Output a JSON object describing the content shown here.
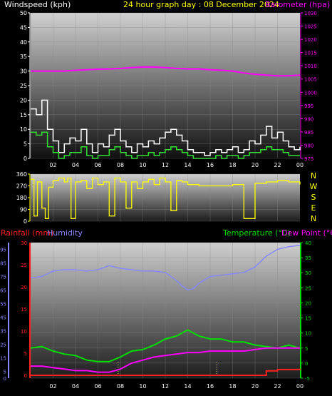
{
  "header": {
    "windspeed_label": "Windspeed (kph)",
    "center_title": "24 hour graph day : 08 December 2024",
    "barometer_label": "Barometer (hpa)",
    "rainfall_label": "Rainfall (mm)",
    "humidity_label": "Humidity",
    "temperature_label": "Temperature (°C)",
    "dewpoint_label": "Dew Point (°C)"
  },
  "colors": {
    "windspeed_label": "#ffffff",
    "title": "#ffff00",
    "barometer": "#ff00ff",
    "gust": "#ffffff",
    "avg_wind": "#33dd33",
    "direction": "#ffff00",
    "rainfall": "#ff2020",
    "humidity": "#8888ff",
    "temperature": "#00dd00",
    "dewpoint": "#ff00ff",
    "compass": "#ffff00"
  },
  "compass": [
    "N",
    "W",
    "S",
    "E",
    "N"
  ],
  "chart_data": [
    {
      "type": "line",
      "x_ticks": [
        "02",
        "04",
        "06",
        "08",
        "10",
        "12",
        "14",
        "16",
        "18",
        "20",
        "22",
        "00"
      ],
      "y_left_ticks": [
        "0",
        "5",
        "10",
        "15",
        "20",
        "25",
        "30",
        "35",
        "40",
        "45",
        "50"
      ],
      "y_right_ticks": [
        "975",
        "980",
        "985",
        "990",
        "995",
        "1000",
        "1005",
        "1010",
        "1015",
        "1020",
        "1025",
        "1030"
      ],
      "ylim_left": [
        0,
        50
      ],
      "ylim_right": [
        975,
        1030
      ],
      "series": [
        {
          "name": "Windspeed (kph)",
          "axis": "left",
          "x": [
            0,
            0.5,
            1,
            1.5,
            2,
            2.5,
            3,
            3.5,
            4,
            4.5,
            5,
            5.5,
            6,
            6.5,
            7,
            7.5,
            8,
            8.5,
            9,
            9.5,
            10,
            10.5,
            11,
            11.5,
            12,
            12.5,
            13,
            13.5,
            14,
            14.5,
            15,
            15.5,
            16,
            16.5,
            17,
            17.5,
            18,
            18.5,
            19,
            19.5,
            20,
            20.5,
            21,
            21.5,
            22,
            22.5,
            23,
            23.5,
            24
          ],
          "values": [
            17,
            15,
            20,
            10,
            6,
            2,
            5,
            7,
            6,
            10,
            5,
            2,
            5,
            4,
            8,
            10,
            6,
            4,
            2,
            5,
            4,
            6,
            5,
            7,
            9,
            10,
            8,
            6,
            3,
            2,
            2,
            1,
            2,
            3,
            2,
            3,
            4,
            2,
            3,
            6,
            5,
            8,
            11,
            7,
            9,
            6,
            4,
            3,
            4
          ]
        },
        {
          "name": "Average",
          "axis": "left",
          "x": [
            0,
            0.5,
            1,
            1.5,
            2,
            2.5,
            3,
            3.5,
            4,
            4.5,
            5,
            5.5,
            6,
            6.5,
            7,
            7.5,
            8,
            8.5,
            9,
            9.5,
            10,
            10.5,
            11,
            11.5,
            12,
            12.5,
            13,
            13.5,
            14,
            14.5,
            15,
            15.5,
            16,
            16.5,
            17,
            17.5,
            18,
            18.5,
            19,
            19.5,
            20,
            20.5,
            21,
            21.5,
            22,
            22.5,
            23,
            23.5,
            24
          ],
          "values": [
            9,
            8,
            9,
            4,
            2,
            0,
            1,
            2,
            2,
            4,
            1,
            0,
            1,
            1,
            3,
            4,
            2,
            1,
            0,
            1,
            1,
            2,
            1,
            2,
            3,
            4,
            3,
            2,
            1,
            0,
            0,
            0,
            0,
            1,
            0,
            1,
            1,
            0,
            1,
            2,
            2,
            3,
            4,
            3,
            3,
            2,
            1,
            1,
            1
          ]
        },
        {
          "name": "Barometer (hpa)",
          "axis": "right",
          "x": [
            0,
            1,
            2,
            3,
            4,
            5,
            6,
            7,
            8,
            9,
            10,
            11,
            12,
            13,
            14,
            15,
            16,
            17,
            18,
            19,
            20,
            21,
            22,
            23,
            24
          ],
          "values": [
            1008,
            1008,
            1008,
            1008,
            1008.3,
            1008.5,
            1008.7,
            1008.8,
            1009,
            1009.3,
            1009.5,
            1009.5,
            1009.3,
            1009,
            1008.8,
            1008.8,
            1008.5,
            1008.3,
            1008,
            1007.3,
            1006.8,
            1006.5,
            1006.2,
            1006.2,
            1006.5
          ]
        }
      ]
    },
    {
      "type": "line",
      "x_ticks": [
        "02",
        "04",
        "06",
        "08",
        "10",
        "12",
        "14",
        "16",
        "18",
        "20",
        "22",
        "00"
      ],
      "y_ticks": [
        "0",
        "90",
        "180",
        "270",
        "360"
      ],
      "ylim": [
        0,
        360
      ],
      "series": [
        {
          "name": "Wind direction",
          "x": [
            0,
            0.3,
            0.6,
            1,
            1.3,
            1.6,
            2,
            2.5,
            3,
            3.3,
            3.6,
            4,
            4.5,
            5,
            5.5,
            6,
            6.5,
            7,
            7.5,
            8,
            8.5,
            9,
            9.5,
            10,
            10.5,
            11,
            11.5,
            12,
            12.5,
            13,
            13.5,
            14,
            15,
            16,
            17,
            18,
            19,
            20,
            21,
            22,
            23,
            24
          ],
          "values": [
            320,
            40,
            300,
            100,
            20,
            260,
            310,
            330,
            300,
            330,
            20,
            300,
            310,
            250,
            330,
            280,
            300,
            40,
            330,
            300,
            100,
            300,
            250,
            300,
            320,
            280,
            330,
            300,
            80,
            310,
            300,
            280,
            270,
            270,
            270,
            280,
            20,
            290,
            300,
            310,
            300,
            280
          ]
        }
      ]
    },
    {
      "type": "line",
      "x_ticks": [
        "02",
        "04",
        "06",
        "08",
        "10",
        "12",
        "14",
        "16",
        "18",
        "20",
        "22",
        "00"
      ],
      "y_humidity_ticks": [
        "0",
        "5",
        "15",
        "25",
        "35",
        "45",
        "55",
        "65",
        "75",
        "85",
        "95"
      ],
      "y_rain_ticks": [
        "0",
        "5",
        "10",
        "15",
        "20",
        "25",
        "30"
      ],
      "y_temp_ticks": [
        "-5",
        "0",
        "5",
        "10",
        "15",
        "20",
        "25",
        "30",
        "35",
        "40"
      ],
      "ylim_humidity": [
        0,
        100
      ],
      "ylim_temp": [
        -5,
        40
      ],
      "series": [
        {
          "name": "Rainfall (mm)",
          "axis": "rain",
          "x": [
            0,
            16,
            19,
            20,
            21,
            22,
            23,
            24
          ],
          "values": [
            0,
            0,
            0,
            0,
            1,
            1.3,
            1.3,
            1.5
          ]
        },
        {
          "name": "Humidity",
          "axis": "humidity",
          "x": [
            0,
            1,
            2,
            3,
            4,
            5,
            6,
            7,
            8,
            9,
            10,
            11,
            12,
            13,
            13.5,
            14,
            14.5,
            15,
            16,
            17,
            18,
            19,
            20,
            21,
            22,
            23,
            24
          ],
          "values": [
            74,
            75,
            79,
            80,
            80,
            79,
            80,
            83,
            81,
            80,
            79,
            79,
            78,
            72,
            68,
            65,
            66,
            70,
            75,
            76,
            77,
            78,
            82,
            90,
            95,
            97,
            98
          ]
        },
        {
          "name": "Temperature (°C)",
          "axis": "temp",
          "x": [
            0,
            1,
            2,
            3,
            4,
            5,
            6,
            7,
            8,
            9,
            10,
            11,
            12,
            13,
            14,
            15,
            16,
            17,
            18,
            19,
            20,
            21,
            22,
            23,
            24
          ],
          "values": [
            5,
            5.5,
            4,
            3,
            2.5,
            1,
            0.5,
            0.5,
            2,
            4,
            4.5,
            6,
            8,
            9,
            11,
            9,
            8,
            8,
            7,
            7,
            6,
            5.5,
            5,
            6,
            5
          ]
        },
        {
          "name": "Dew Point (°C)",
          "axis": "temp",
          "x": [
            0,
            1,
            2,
            3,
            4,
            5,
            6,
            7,
            8,
            9,
            10,
            11,
            12,
            13,
            14,
            15,
            16,
            17,
            18,
            19,
            20,
            21,
            22,
            23,
            24
          ],
          "values": [
            -1,
            -1,
            -1.5,
            -2,
            -2.5,
            -2.5,
            -3,
            -3,
            -2,
            0,
            1,
            2,
            2.5,
            3,
            3.5,
            3.5,
            4,
            4,
            4,
            4,
            4.5,
            5,
            5,
            5,
            5
          ]
        }
      ]
    }
  ]
}
